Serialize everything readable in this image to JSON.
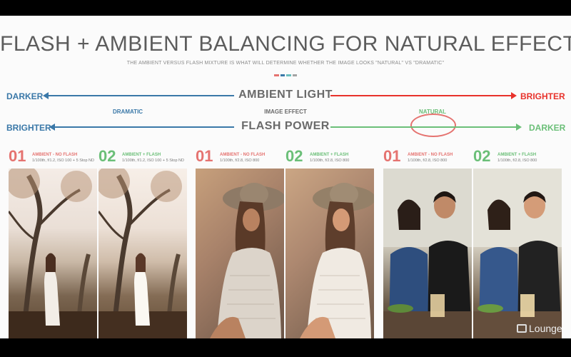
{
  "slide": {
    "title": "FLASH + AMBIENT BALANCING FOR NATURAL EFFECT",
    "subtitle": "THE AMBIENT VERSUS FLASH MIXTURE IS WHAT WILL DETERMINE WHETHER THE IMAGE LOOKS \"NATURAL\" VS \"DRAMATIC\""
  },
  "colors": {
    "blue": "#3a78a8",
    "red": "#e8322b",
    "green": "#6bbf78",
    "salmon": "#e57370",
    "accent_dashes": [
      "#e57370",
      "#3a78a8",
      "#6bbfbf",
      "#a3a3a3"
    ]
  },
  "scale": {
    "ambient_row": {
      "left": "DARKER",
      "center": "AMBIENT LIGHT",
      "right": "BRIGHTER"
    },
    "effect_row": {
      "left": "DRAMATIC",
      "center": "IMAGE EFFECT",
      "right": "NATURAL"
    },
    "flash_row": {
      "left": "BRIGHTER",
      "center": "FLASH POWER",
      "right": "DARKER"
    }
  },
  "sets": [
    {
      "ambient": {
        "num": "01",
        "title": "AMBIENT - NO FLASH",
        "settings": "1/100th, f/1.2, ISO 100 + 5 Stop ND"
      },
      "flash": {
        "num": "02",
        "title": "AMBIENT + FLASH",
        "settings": "1/100th, f/1.2, ISO 100 + 5 Stop ND"
      }
    },
    {
      "ambient": {
        "num": "01",
        "title": "AMBIENT - NO FLASH",
        "settings": "1/100th, f/2.8, ISO 800"
      },
      "flash": {
        "num": "02",
        "title": "AMBIENT + FLASH",
        "settings": "1/100th, f/2.8, ISO 800"
      }
    },
    {
      "ambient": {
        "num": "01",
        "title": "AMBIENT - NO FLASH",
        "settings": "1/100th, f/2.8, ISO 800"
      },
      "flash": {
        "num": "02",
        "title": "AMBIENT + FLASH",
        "settings": "1/100th, f/2.8, ISO 800"
      }
    }
  ],
  "photos": [
    "forest-woman-photo",
    "hat-woman-photo",
    "couple-cafe-photo"
  ],
  "watermark": {
    "brand": "Lounge"
  }
}
